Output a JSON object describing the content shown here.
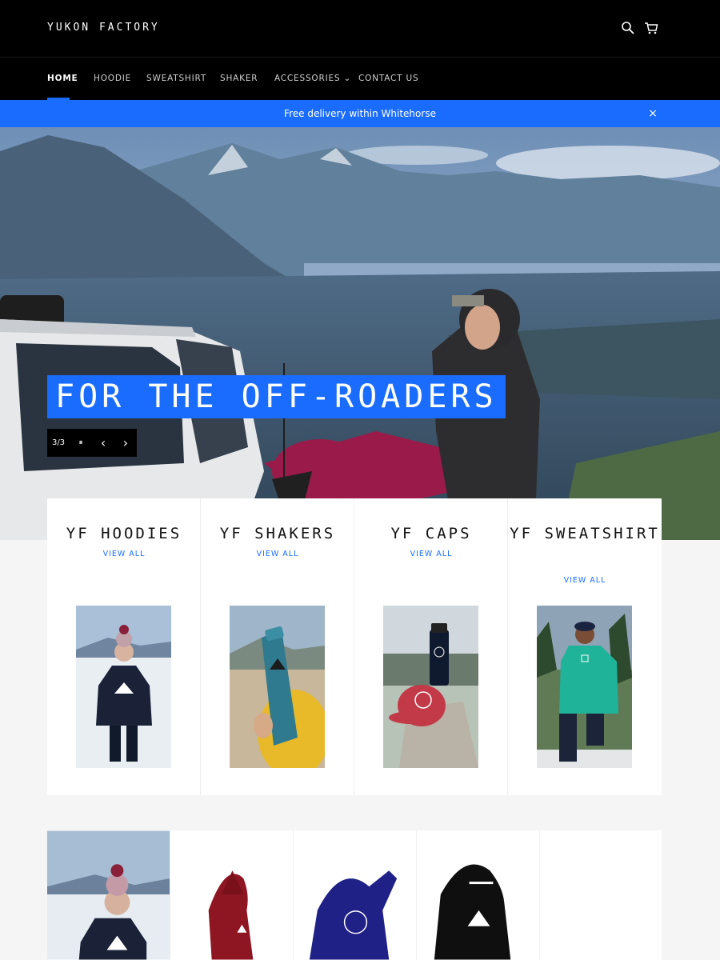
{
  "header": {
    "logo": "YUKON FACTORY",
    "icons": [
      "search-icon",
      "cart-icon"
    ]
  },
  "nav": {
    "items": [
      {
        "label": "HOME",
        "active": true
      },
      {
        "label": "HOODIE"
      },
      {
        "label": "SWEATSHIRT"
      },
      {
        "label": "SHAKER"
      },
      {
        "label": "ACCESSORIES ⌄"
      },
      {
        "label": "CONTACT US"
      }
    ]
  },
  "announcement": {
    "text": "Free delivery within Whitehorse",
    "close": "×"
  },
  "hero": {
    "title": "FOR THE OFF-ROADERS",
    "counter": "3/3",
    "pause": "⏸",
    "prev": "‹",
    "next": "›"
  },
  "collections": [
    {
      "title": "YF HOODIES",
      "link": "VIEW ALL"
    },
    {
      "title": "YF SHAKERS",
      "link": "VIEW ALL"
    },
    {
      "title": "YF CAPS",
      "link": "VIEW ALL"
    },
    {
      "title": "YF SWEATSHIRT",
      "link": "VIEW ALL"
    }
  ],
  "colors": {
    "accent": "#1a6cff",
    "header_bg": "#000000"
  }
}
